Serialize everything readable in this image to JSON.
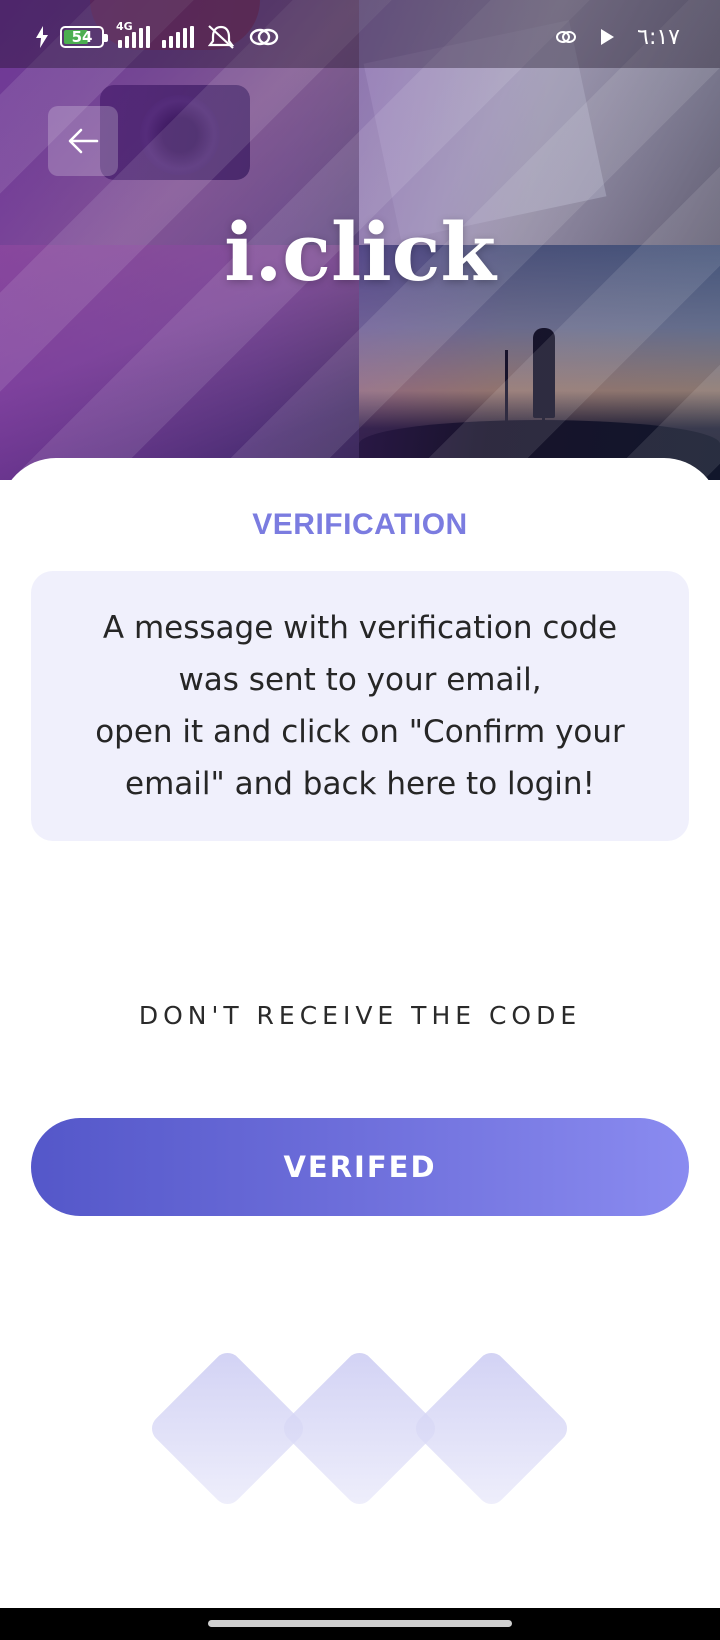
{
  "status_bar": {
    "battery_level": "54",
    "network_type": "4G",
    "time": "٦:١٧",
    "icons": [
      "charging-bolt-icon",
      "battery-icon",
      "signal-icon",
      "signal-icon",
      "mute-icon",
      "link-icon",
      "link-icon",
      "play-icon"
    ]
  },
  "header": {
    "back_icon": "arrow-left-icon",
    "logo_text": "i.click"
  },
  "verification": {
    "title": "VERIFICATION",
    "message": "A message with verification code\nwas sent to your email,\nopen it and click on \"Confirm your email\" and back here to login!",
    "resend_label": "DON'T RECEIVE THE CODE",
    "verify_button_label": "VERIFED"
  },
  "colors": {
    "accent": "#7b7ce0",
    "button_start": "#5457c9",
    "button_end": "#8a8bf0",
    "message_bg": "#f0f0fc"
  }
}
